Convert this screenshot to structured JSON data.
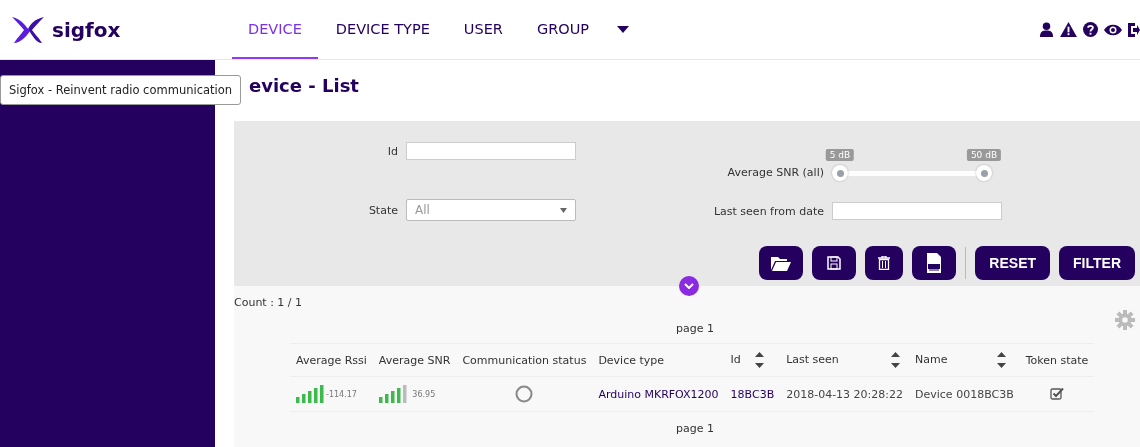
{
  "brand": {
    "name": "sigfox"
  },
  "nav": [
    {
      "label": "DEVICE",
      "selected": true
    },
    {
      "label": "DEVICE TYPE",
      "selected": false
    },
    {
      "label": "USER",
      "selected": false
    },
    {
      "label": "GROUP",
      "selected": false
    }
  ],
  "tooltip": "Sigfox - Reinvent radio communication",
  "page_title": "evice - List",
  "filters": {
    "id": {
      "label": "Id"
    },
    "state": {
      "label": "State",
      "value": "All"
    },
    "snr": {
      "label": "Average SNR (all)",
      "thumbs": [
        {
          "tooltip": "5 dB",
          "level": 0
        },
        {
          "tooltip": "50 dB",
          "level": 1
        }
      ]
    },
    "last_seen": {
      "label": "Last seen from date"
    },
    "buttons": [
      "RESET",
      "FILTER"
    ]
  },
  "count": "Count : 1 / 1",
  "pager_top": "page 1",
  "pager_bottom": "page 1",
  "table": {
    "columns": [
      {
        "label": "Average Rssi",
        "sortable": false
      },
      {
        "label": "Average SNR",
        "sortable": false
      },
      {
        "label": "Communication status",
        "sortable": false
      },
      {
        "label": "Device type",
        "sortable": false
      },
      {
        "label": "Id",
        "sortable": true
      },
      {
        "label": "Last seen",
        "sortable": true
      },
      {
        "label": "Name",
        "sortable": true
      },
      {
        "label": "Token state",
        "sortable": false
      }
    ],
    "rows": [
      {
        "rssi": "-114.17",
        "snr": "36.95",
        "device_type": "Arduino MKRFOX1200",
        "id": "18BC3B",
        "last_seen": "2018-04-13 20:28:22",
        "name": "Device 0018BC3B",
        "token_checked": true
      }
    ]
  }
}
